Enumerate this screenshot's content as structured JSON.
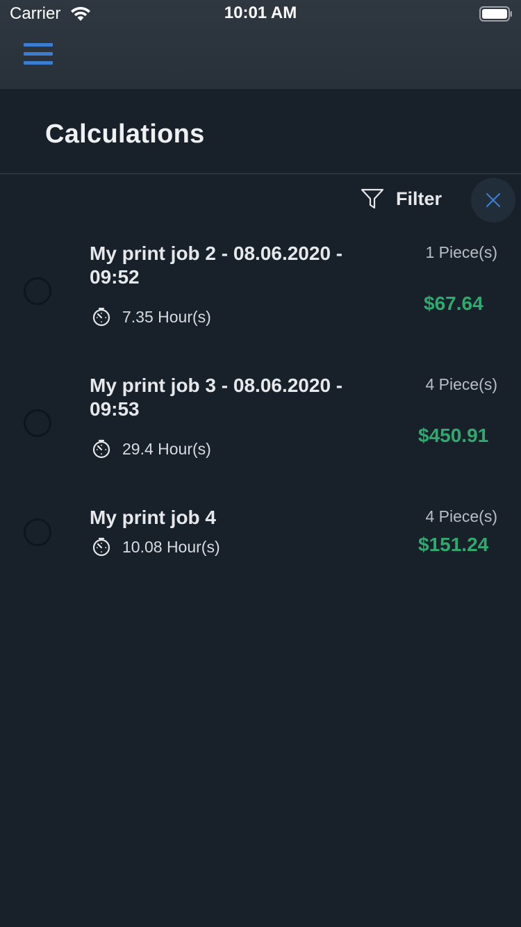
{
  "status_bar": {
    "carrier": "Carrier",
    "time": "10:01 AM"
  },
  "nav": {
    "menu_icon": "hamburger-menu-icon"
  },
  "page": {
    "title": "Calculations"
  },
  "filter": {
    "label": "Filter",
    "icon": "funnel-icon",
    "close_icon": "close-icon"
  },
  "colors": {
    "background": "#18202a",
    "header": "#2d353f",
    "accent_blue": "#3b7dd1",
    "price_green": "#2eaa6e"
  },
  "items": [
    {
      "title": "My print job 2 - 08.06.2020 - 09:52",
      "duration": "7.35 Hour(s)",
      "pieces": "1 Piece(s)",
      "price": "$67.64"
    },
    {
      "title": "My print job 3 - 08.06.2020 - 09:53",
      "duration": "29.4 Hour(s)",
      "pieces": "4 Piece(s)",
      "price": "$450.91"
    },
    {
      "title": "My print job 4",
      "duration": "10.08 Hour(s)",
      "pieces": "4 Piece(s)",
      "price": "$151.24"
    }
  ]
}
